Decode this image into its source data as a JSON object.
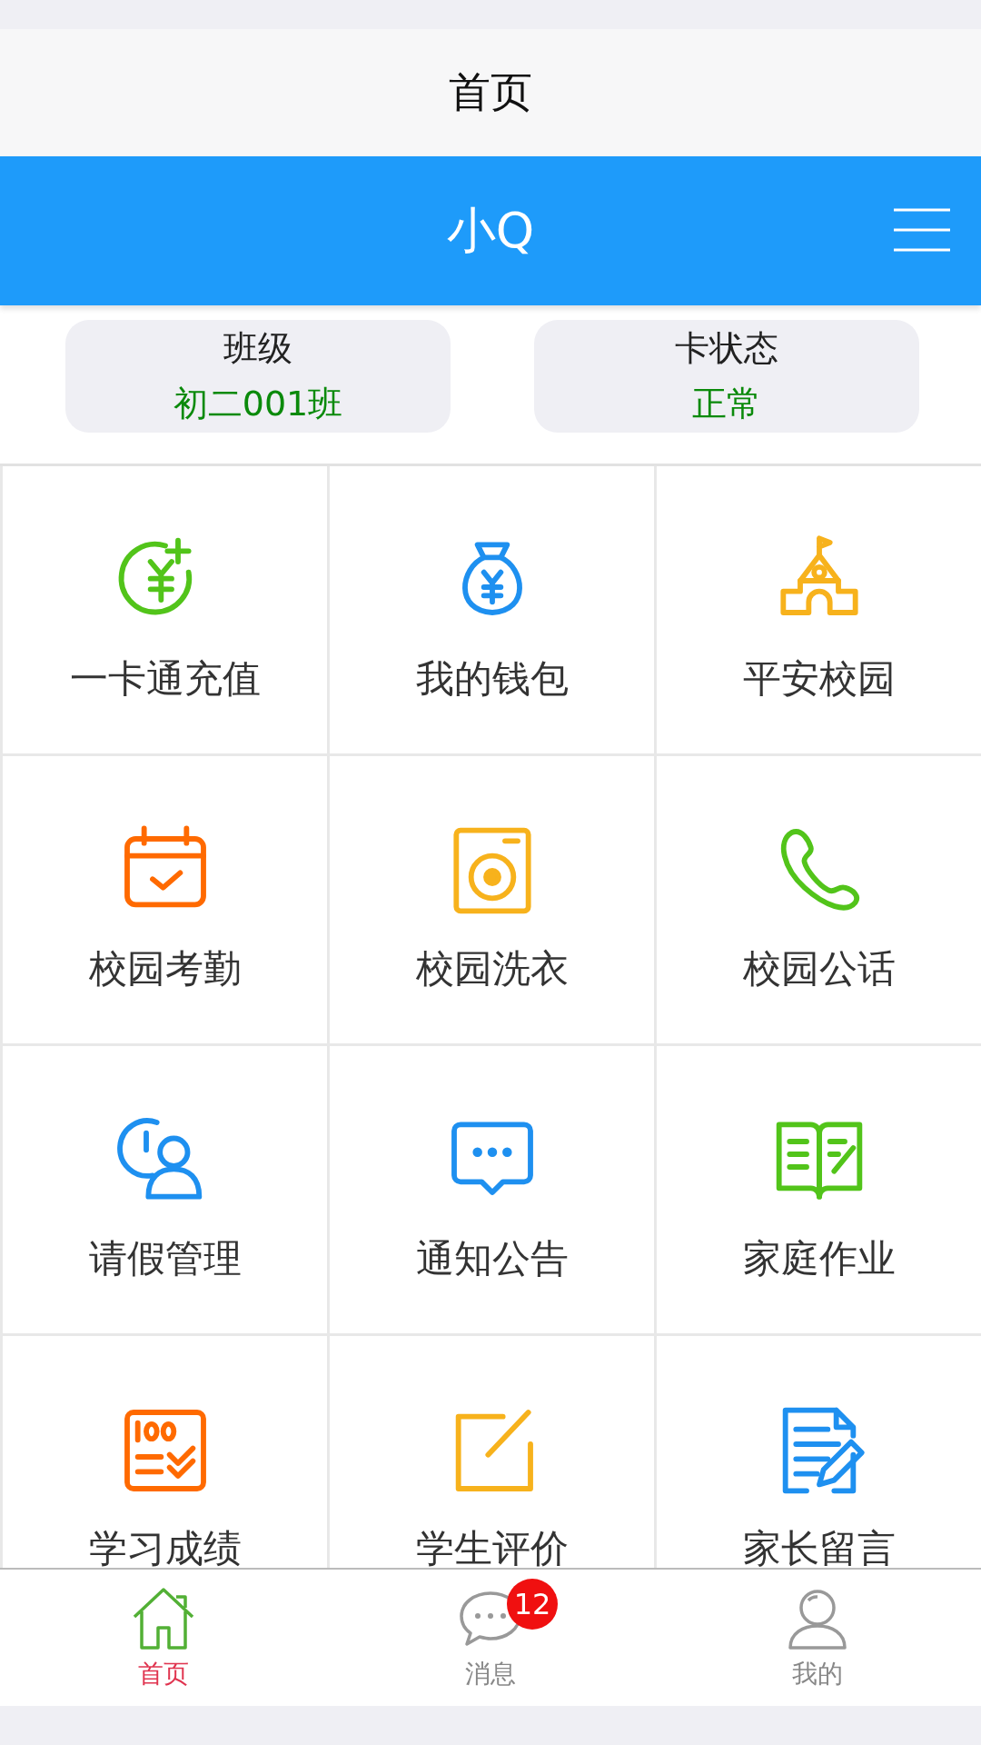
{
  "title_bar": {
    "title": "首页"
  },
  "header": {
    "title": "小Q"
  },
  "info_cards": [
    {
      "label": "班级",
      "value": "初二001班"
    },
    {
      "label": "卡状态",
      "value": "正常"
    }
  ],
  "grid_items": [
    {
      "label": "一卡通充值"
    },
    {
      "label": "我的钱包"
    },
    {
      "label": "平安校园"
    },
    {
      "label": "校园考勤"
    },
    {
      "label": "校园洗衣"
    },
    {
      "label": "校园公话"
    },
    {
      "label": "请假管理"
    },
    {
      "label": "通知公告"
    },
    {
      "label": "家庭作业"
    },
    {
      "label": "学习成绩"
    },
    {
      "label": "学生评价"
    },
    {
      "label": "家长留言"
    }
  ],
  "tab_bar": [
    {
      "label": "首页",
      "selected": true
    },
    {
      "label": "消息",
      "selected": false,
      "badge": "12"
    },
    {
      "label": "我的",
      "selected": false
    }
  ]
}
